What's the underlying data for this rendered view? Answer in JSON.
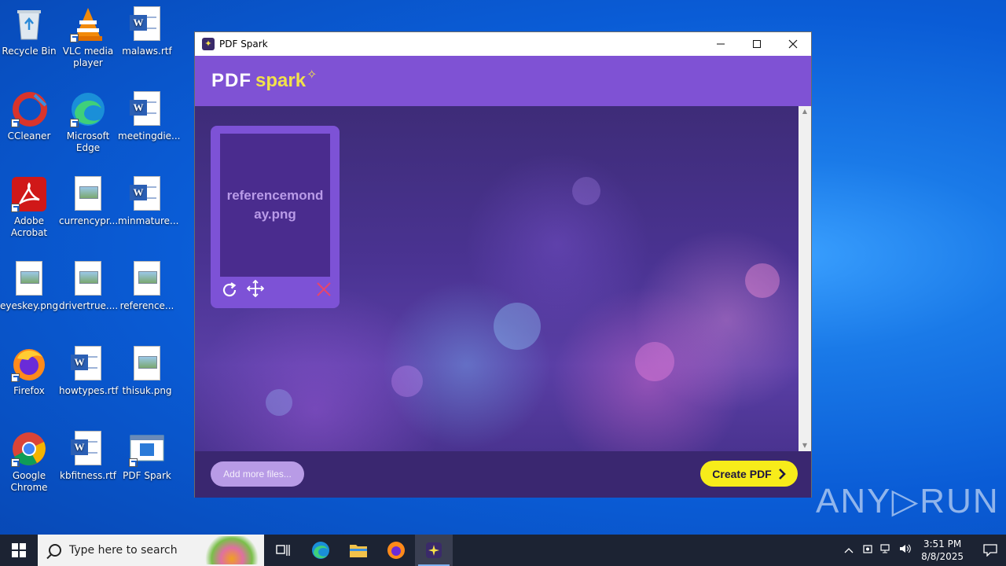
{
  "desktop": {
    "icons": [
      {
        "label": "Recycle Bin"
      },
      {
        "label": "VLC media player"
      },
      {
        "label": "malaws.rtf"
      },
      {
        "label": "CCleaner"
      },
      {
        "label": "Microsoft Edge"
      },
      {
        "label": "meetingdie..."
      },
      {
        "label": "Adobe Acrobat"
      },
      {
        "label": "currencypr..."
      },
      {
        "label": "minmature..."
      },
      {
        "label": "eyeskey.png"
      },
      {
        "label": "drivertrue...."
      },
      {
        "label": "reference..."
      },
      {
        "label": "Firefox"
      },
      {
        "label": "howtypes.rtf"
      },
      {
        "label": "thisuk.png"
      },
      {
        "label": "Google Chrome"
      },
      {
        "label": "kbfitness.rtf"
      },
      {
        "label": "PDF Spark"
      }
    ]
  },
  "window": {
    "title": "PDF Spark",
    "logo_pdf": "PDF",
    "logo_spark": "spark",
    "file_card": {
      "filename": "referencemonday.png"
    },
    "add_files_label": "Add more files...",
    "create_pdf_label": "Create PDF"
  },
  "watermark": "ANY▷RUN",
  "taskbar": {
    "search_placeholder": "Type here to search",
    "time": "3:51 PM",
    "date": "8/8/2025"
  },
  "colors": {
    "header": "#7f52d4",
    "create_button": "#f7ec1a",
    "add_button": "#b89be6",
    "footer": "#3a2770"
  }
}
